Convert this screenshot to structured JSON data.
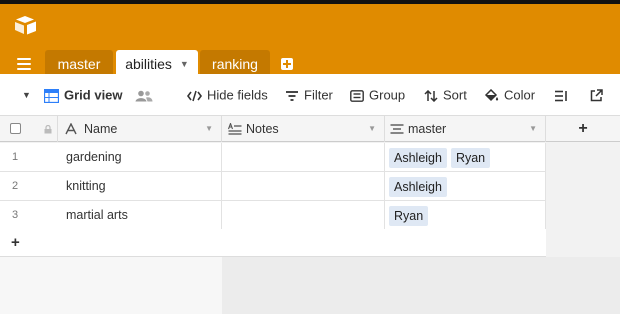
{
  "tabs": [
    {
      "label": "master"
    },
    {
      "label": "abilities",
      "caret": "▼"
    },
    {
      "label": "ranking"
    }
  ],
  "toolbar": {
    "view_caret": "▼",
    "view_name": "Grid view",
    "hide_fields": "Hide fields",
    "filter": "Filter",
    "group": "Group",
    "sort": "Sort",
    "color": "Color"
  },
  "columns": {
    "name": "Name",
    "notes": "Notes",
    "master": "master",
    "add": "+"
  },
  "rows": [
    {
      "num": "1",
      "name": "gardening",
      "notes": "",
      "master": [
        "Ashleigh",
        "Ryan"
      ]
    },
    {
      "num": "2",
      "name": "knitting",
      "notes": "",
      "master": [
        "Ashleigh"
      ]
    },
    {
      "num": "3",
      "name": "martial arts",
      "notes": "",
      "master": [
        "Ryan"
      ]
    }
  ],
  "add_row": "+",
  "colors": {
    "brand": "#e08b00",
    "tab_inactive": "#c47900",
    "pill": "#dfe8f4"
  }
}
